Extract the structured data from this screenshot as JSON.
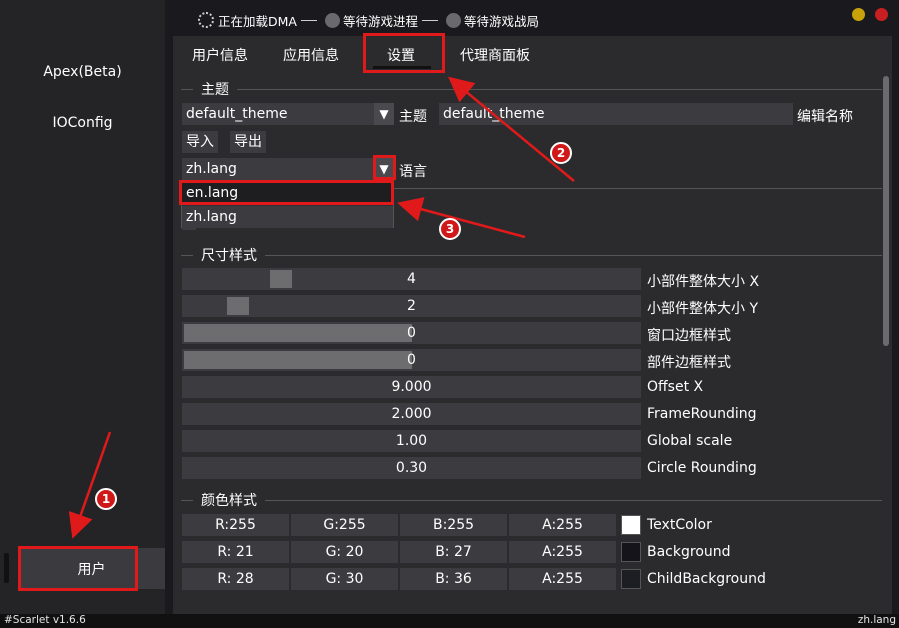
{
  "status": {
    "step1": "正在加载DMA",
    "step2": "等待游戏进程",
    "step3": "等待游戏战局"
  },
  "sidebar": {
    "items": [
      {
        "label": "Apex(Beta)"
      },
      {
        "label": "IOConfig"
      }
    ],
    "user": "用户"
  },
  "tabs": [
    "用户信息",
    "应用信息",
    "设置",
    "代理商面板"
  ],
  "active_tab": "设置",
  "theme": {
    "section": "主题",
    "selected": "default_theme",
    "label": "主题",
    "edit_value": "default_theme",
    "edit_label": "编辑名称",
    "import_label": "导入",
    "export_label": "导出",
    "lang_selected": "zh.lang",
    "lang_label": "语言",
    "lang_options": [
      "en.lang",
      "zh.lang"
    ]
  },
  "size_style": {
    "section": "尺寸样式",
    "rows": [
      {
        "value": "4",
        "label": "小部件整体大小 X",
        "level": 0.22
      },
      {
        "value": "2",
        "label": "小部件整体大小 Y",
        "level": 0.11
      },
      {
        "value": "0",
        "label": "窗口边框样式",
        "level": 0.5
      },
      {
        "value": "0",
        "label": "部件边框样式",
        "level": 0.5
      },
      {
        "value": "9.000",
        "label": "Offset X"
      },
      {
        "value": "2.000",
        "label": "FrameRounding"
      },
      {
        "value": "1.00",
        "label": "Global scale"
      },
      {
        "value": "0.30",
        "label": "Circle Rounding"
      }
    ]
  },
  "color_style": {
    "section": "颜色样式",
    "rows": [
      {
        "r": "R:255",
        "g": "G:255",
        "b": "B:255",
        "a": "A:255",
        "label": "TextColor",
        "swatch": "#ffffff"
      },
      {
        "r": "R: 21",
        "g": "G: 20",
        "b": "B: 27",
        "a": "A:255",
        "label": "Background",
        "swatch": "#15141b"
      },
      {
        "r": "R: 28",
        "g": "G: 30",
        "b": "B: 36",
        "a": "A:255",
        "label": "ChildBackground",
        "swatch": "#1c1e24"
      }
    ]
  },
  "annotations": [
    "1",
    "2",
    "3"
  ],
  "footer": {
    "left": "#Scarlet  v1.6.6",
    "right": "zh.lang"
  },
  "colors": {
    "accent_red": "#e01a1a",
    "window_yellow": "#c9a20a",
    "window_red": "#c71f22"
  }
}
